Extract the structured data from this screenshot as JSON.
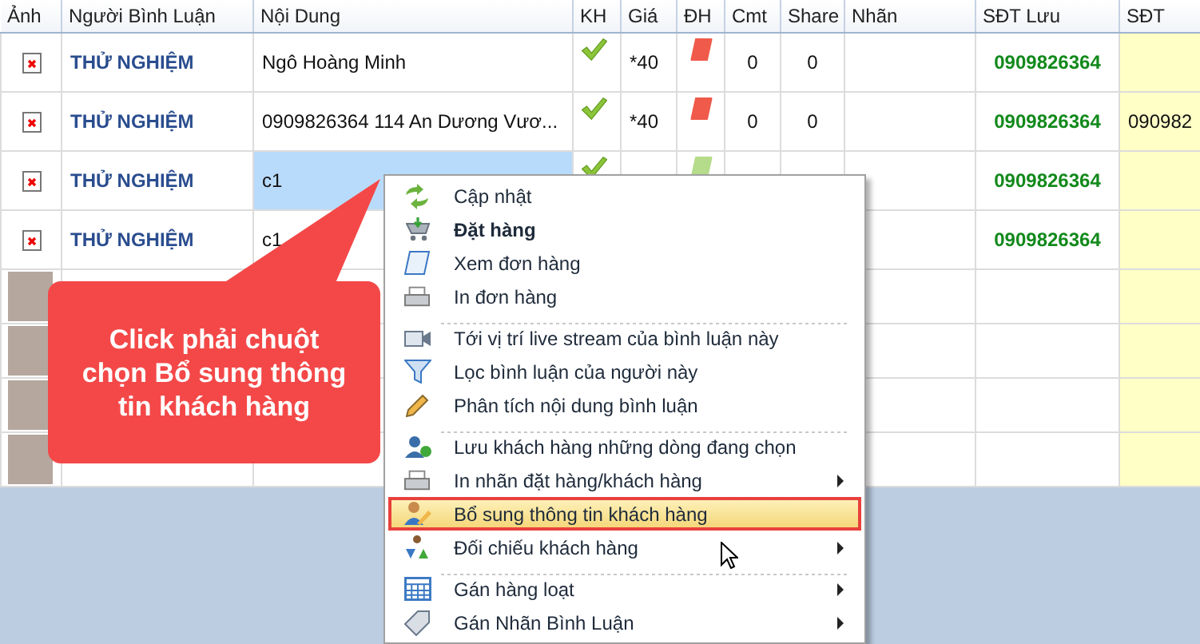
{
  "table": {
    "columns": [
      "Ảnh",
      "Người Bình Luận",
      "Nội Dung",
      "KH",
      "Giá",
      "ĐH",
      "Cmt",
      "Share",
      "Nhãn",
      "SĐT Lưu",
      "SĐT"
    ],
    "rows": [
      {
        "kind": "comment",
        "commenter": "THỬ NGHIỆM",
        "content": "Ngô Hoàng Minh",
        "customer": true,
        "price": "*40",
        "color": "#f05a4a",
        "comments": "0",
        "shares": "0",
        "saved_phone": "0909826364",
        "selected": false
      },
      {
        "kind": "comment",
        "commenter": "THỬ NGHIỆM",
        "content": "0909826364 114 An Dương Vươ...",
        "customer": true,
        "price": "*40",
        "color": "#f05a4a",
        "comments": "0",
        "shares": "0",
        "saved_phone": "0909826364",
        "phone": "090982",
        "selected": false
      },
      {
        "kind": "comment",
        "commenter": "THỬ NGHIỆM",
        "content": "c1",
        "customer": true,
        "color": "#b5dc8a",
        "saved_phone": "0909826364",
        "selected": true
      },
      {
        "kind": "comment",
        "commenter": "THỬ NGHIỆM",
        "content": "c1",
        "saved_phone": "0909826364",
        "selected": false
      },
      {
        "kind": "photo"
      },
      {
        "kind": "photo"
      },
      {
        "kind": "photo"
      },
      {
        "kind": "photo"
      }
    ]
  },
  "context_menu": {
    "items": [
      {
        "label": "Cập nhật",
        "bold": false,
        "submenu": false,
        "selected": false,
        "separator_before": false
      },
      {
        "label": "Đặt hàng",
        "bold": true,
        "submenu": false,
        "selected": false,
        "separator_before": false
      },
      {
        "label": "Xem đơn hàng",
        "bold": false,
        "submenu": false,
        "selected": false,
        "separator_before": false
      },
      {
        "label": "In đơn hàng",
        "bold": false,
        "submenu": false,
        "selected": false,
        "separator_before": false
      },
      {
        "label": "Tới vị trí live stream của bình luận này",
        "bold": false,
        "submenu": false,
        "selected": false,
        "separator_before": true
      },
      {
        "label": "Lọc bình luận của người này",
        "bold": false,
        "submenu": false,
        "selected": false,
        "separator_before": false
      },
      {
        "label": "Phân tích nội dung bình luận",
        "bold": false,
        "submenu": false,
        "selected": false,
        "separator_before": false
      },
      {
        "label": "Lưu khách hàng những dòng đang chọn",
        "bold": false,
        "submenu": false,
        "selected": false,
        "separator_before": true
      },
      {
        "label": "In nhãn đặt hàng/khách hàng",
        "bold": false,
        "submenu": true,
        "selected": false,
        "separator_before": false
      },
      {
        "label": "Bổ sung thông tin khách hàng",
        "bold": false,
        "submenu": false,
        "selected": true,
        "separator_before": false
      },
      {
        "label": "Đối chiếu khách hàng",
        "bold": false,
        "submenu": true,
        "selected": false,
        "separator_before": false
      },
      {
        "label": "Gán hàng loạt",
        "bold": false,
        "submenu": true,
        "selected": false,
        "separator_before": true
      },
      {
        "label": "Gán Nhãn Bình Luận",
        "bold": false,
        "submenu": true,
        "selected": false,
        "separator_before": false
      }
    ]
  },
  "callout": {
    "text": "Click phải chuột chọn Bổ sung thông tin khách hàng"
  }
}
